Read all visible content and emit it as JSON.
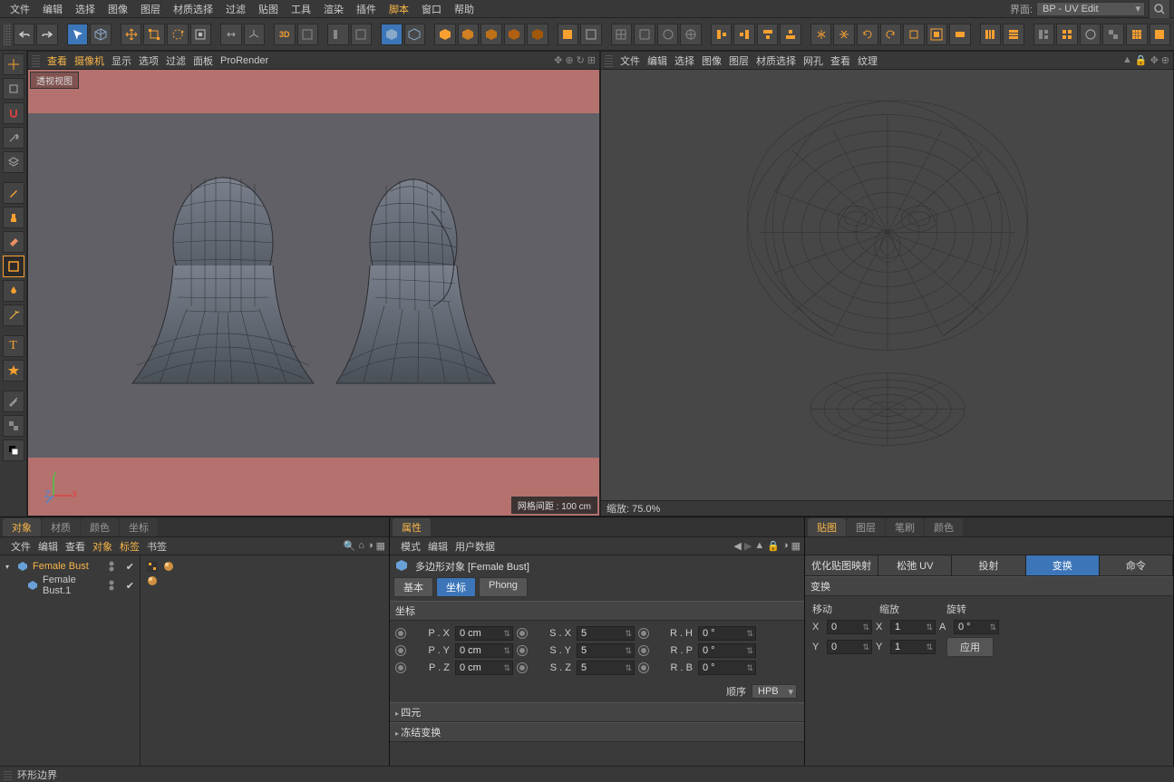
{
  "menu": {
    "items": [
      "文件",
      "编辑",
      "选择",
      "图像",
      "图层",
      "材质选择",
      "过滤",
      "贴图",
      "工具",
      "渲染",
      "插件",
      "脚本",
      "窗口",
      "帮助"
    ],
    "hl_index": 11,
    "layout_label": "界面:",
    "layout_value": "BP - UV Edit"
  },
  "left_viewport": {
    "menus": [
      "查看",
      "摄像机",
      "显示",
      "选项",
      "过滤",
      "面板",
      "ProRender"
    ],
    "hl": [
      0,
      1
    ],
    "label": "透视视图",
    "grid": "网格间距 : 100 cm"
  },
  "uv_viewport": {
    "menus": [
      "文件",
      "编辑",
      "选择",
      "图像",
      "图层",
      "材质选择",
      "网孔",
      "查看",
      "纹理"
    ],
    "zoom": "缩放: 75.0%"
  },
  "obj_pane": {
    "tabs": [
      "对象",
      "材质",
      "颜色",
      "坐标"
    ],
    "active": 0,
    "menus": [
      "文件",
      "编辑",
      "查看",
      "对象",
      "标签",
      "书签"
    ],
    "hl": [
      3,
      4
    ],
    "rows": [
      {
        "name": "Female Bust",
        "sel": true,
        "expand": true
      },
      {
        "name": "Female Bust.1",
        "sel": false,
        "expand": false
      }
    ]
  },
  "attr_pane": {
    "tab": "属性",
    "menus": [
      "模式",
      "编辑",
      "用户数据"
    ],
    "object_label": "多边形对象 [Female Bust]",
    "subtabs": [
      "基本",
      "坐标",
      "Phong"
    ],
    "active": 1,
    "section": "坐标",
    "rows": [
      {
        "p": "P . X",
        "pv": "0 cm",
        "s": "S . X",
        "sv": "5",
        "r": "R . H",
        "rv": "0 °"
      },
      {
        "p": "P . Y",
        "pv": "0 cm",
        "s": "S . Y",
        "sv": "5",
        "r": "R . P",
        "rv": "0 °"
      },
      {
        "p": "P . Z",
        "pv": "0 cm",
        "s": "S . Z",
        "sv": "5",
        "r": "R . B",
        "rv": "0 °"
      }
    ],
    "order_label": "顺序",
    "order_value": "HPB",
    "folds": [
      "四元",
      "冻结变换"
    ]
  },
  "tex_pane": {
    "tabs": [
      "贴图",
      "图层",
      "笔刷",
      "颜色"
    ],
    "active": 0,
    "buttons": [
      "优化贴图映射",
      "松弛 UV",
      "投射",
      "变换",
      "命令"
    ],
    "active_btn": 3,
    "section": "变换",
    "cols": [
      "移动",
      "缩放",
      "旋转"
    ],
    "r1": {
      "xv": "0",
      "sv": "1",
      "al": "A",
      "rv": "0 °"
    },
    "r2": {
      "yv": "0",
      "sv": "1",
      "apply": "应用"
    }
  },
  "status": "环形边界"
}
